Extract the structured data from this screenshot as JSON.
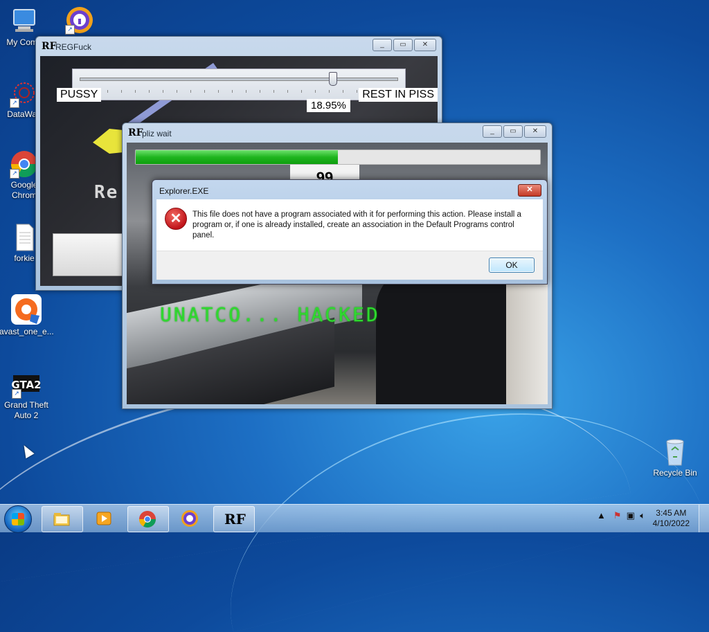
{
  "desktop": {
    "icons": [
      {
        "label": "My Comp",
        "icon": "computer-icon"
      },
      {
        "label": "",
        "icon": "lock-app-icon"
      },
      {
        "label": "DataWag",
        "icon": "datawag-icon"
      },
      {
        "label": "Google Chrom",
        "icon": "chrome-icon"
      },
      {
        "label": "forkie",
        "icon": "text-file-icon"
      },
      {
        "label": "avast_one_e...",
        "icon": "avast-icon"
      },
      {
        "label": "Grand Theft Auto 2",
        "icon": "gta2-icon"
      },
      {
        "label": "Recycle Bin",
        "icon": "recycle-bin-icon"
      }
    ]
  },
  "regfuck_window": {
    "title": "REGFuck",
    "logo": "RF",
    "left_label": "PUSSY",
    "right_label": "REST IN PISS",
    "percent": "18.95%",
    "slider_value": 0.8,
    "overlay_text": "Re"
  },
  "pliz_wait_window": {
    "title": "pliz wait",
    "logo": "RF",
    "progress": 0.5,
    "overlay_text": "UNATCO... HACKED",
    "sign_text": "99"
  },
  "error_dialog": {
    "title": "Explorer.EXE",
    "message": "This file does not have a program associated with it for performing this action. Please install a program or, if one is already installed, create an association in the Default Programs control panel.",
    "ok_label": "OK",
    "icon": "error-icon"
  },
  "taskbar": {
    "apps": [
      {
        "icon": "file-explorer-icon"
      },
      {
        "icon": "media-player-icon"
      },
      {
        "icon": "chrome-icon"
      },
      {
        "icon": "lock-app-icon"
      },
      {
        "icon": "rf-icon",
        "label": "RF"
      }
    ],
    "time": "3:45 AM",
    "date": "4/10/2022"
  },
  "colors": {
    "progress_green": "#1fb51f",
    "hacked_green": "#2fd92f",
    "error_red": "#c0141a",
    "wallpaper_blue": "#1d6fc4"
  }
}
